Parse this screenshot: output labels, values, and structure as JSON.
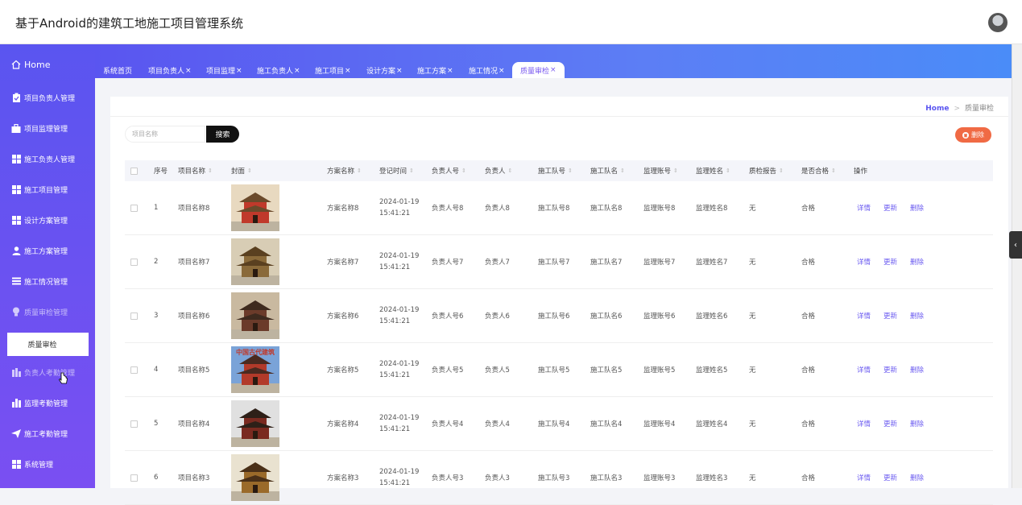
{
  "app": {
    "title": "基于Android的建筑工地施工项目管理系统"
  },
  "sidebar": {
    "items": [
      {
        "label": "Home"
      },
      {
        "label": "项目负责人管理"
      },
      {
        "label": "项目监理管理"
      },
      {
        "label": "施工负责人管理"
      },
      {
        "label": "施工项目管理"
      },
      {
        "label": "设计方案管理"
      },
      {
        "label": "施工方案管理"
      },
      {
        "label": "施工情况管理"
      },
      {
        "label": "质量审检管理"
      },
      {
        "label": "负责人考勤管理"
      },
      {
        "label": "监理考勤管理"
      },
      {
        "label": "施工考勤管理"
      },
      {
        "label": "系统管理"
      }
    ],
    "submenu_label": "质量审检"
  },
  "tabs": [
    {
      "label": "系统首页",
      "closable": false
    },
    {
      "label": "项目负责人",
      "closable": true
    },
    {
      "label": "项目监理",
      "closable": true
    },
    {
      "label": "施工负责人",
      "closable": true
    },
    {
      "label": "施工项目",
      "closable": true
    },
    {
      "label": "设计方案",
      "closable": true
    },
    {
      "label": "施工方案",
      "closable": true
    },
    {
      "label": "施工情况",
      "closable": true
    },
    {
      "label": "质量审检",
      "closable": true,
      "active": true
    }
  ],
  "breadcrumb": {
    "home": "Home",
    "current": "质量审检"
  },
  "search": {
    "placeholder": "项目名称",
    "button": "搜索"
  },
  "actions": {
    "delete": "删除"
  },
  "table": {
    "headers": [
      "序号",
      "项目名称",
      "封面",
      "方案名称",
      "登记时间",
      "负责人号",
      "负责人",
      "施工队号",
      "施工队名",
      "监理账号",
      "监理姓名",
      "质检报告",
      "是否合格",
      "操作"
    ],
    "row_actions": [
      "详情",
      "更新",
      "删除"
    ],
    "rows": [
      {
        "no": "1",
        "project": "项目名称8",
        "plan": "方案名称8",
        "date": "2024-01-19",
        "time": "15:41:21",
        "owner_no": "负责人号8",
        "owner": "负责人8",
        "team_no": "施工队号8",
        "team": "施工队名8",
        "sup_acc": "监理账号8",
        "sup_name": "监理姓名8",
        "report": "无",
        "pass": "合格"
      },
      {
        "no": "2",
        "project": "项目名称7",
        "plan": "方案名称7",
        "date": "2024-01-19",
        "time": "15:41:21",
        "owner_no": "负责人号7",
        "owner": "负责人7",
        "team_no": "施工队号7",
        "team": "施工队名7",
        "sup_acc": "监理账号7",
        "sup_name": "监理姓名7",
        "report": "无",
        "pass": "合格"
      },
      {
        "no": "3",
        "project": "项目名称6",
        "plan": "方案名称6",
        "date": "2024-01-19",
        "time": "15:41:21",
        "owner_no": "负责人号6",
        "owner": "负责人6",
        "team_no": "施工队号6",
        "team": "施工队名6",
        "sup_acc": "监理账号6",
        "sup_name": "监理姓名6",
        "report": "无",
        "pass": "合格"
      },
      {
        "no": "4",
        "project": "项目名称5",
        "plan": "方案名称5",
        "date": "2024-01-19",
        "time": "15:41:21",
        "owner_no": "负责人号5",
        "owner": "负责人5",
        "team_no": "施工队号5",
        "team": "施工队名5",
        "sup_acc": "监理账号5",
        "sup_name": "监理姓名5",
        "report": "无",
        "pass": "合格",
        "cover_text": "中国古代建筑"
      },
      {
        "no": "5",
        "project": "项目名称4",
        "plan": "方案名称4",
        "date": "2024-01-19",
        "time": "15:41:21",
        "owner_no": "负责人号4",
        "owner": "负责人4",
        "team_no": "施工队号4",
        "team": "施工队名4",
        "sup_acc": "监理账号4",
        "sup_name": "监理姓名4",
        "report": "无",
        "pass": "合格"
      },
      {
        "no": "6",
        "project": "项目名称3",
        "plan": "方案名称3",
        "date": "2024-01-19",
        "time": "15:41:21",
        "owner_no": "负责人号3",
        "owner": "负责人3",
        "team_no": "施工队号3",
        "team": "施工队名3",
        "sup_acc": "监理账号3",
        "sup_name": "监理姓名3",
        "report": "无",
        "pass": "合格"
      }
    ]
  },
  "colors": {
    "accent": "#5a55f0",
    "delete": "#f06a44",
    "link": "#6a5af0"
  }
}
